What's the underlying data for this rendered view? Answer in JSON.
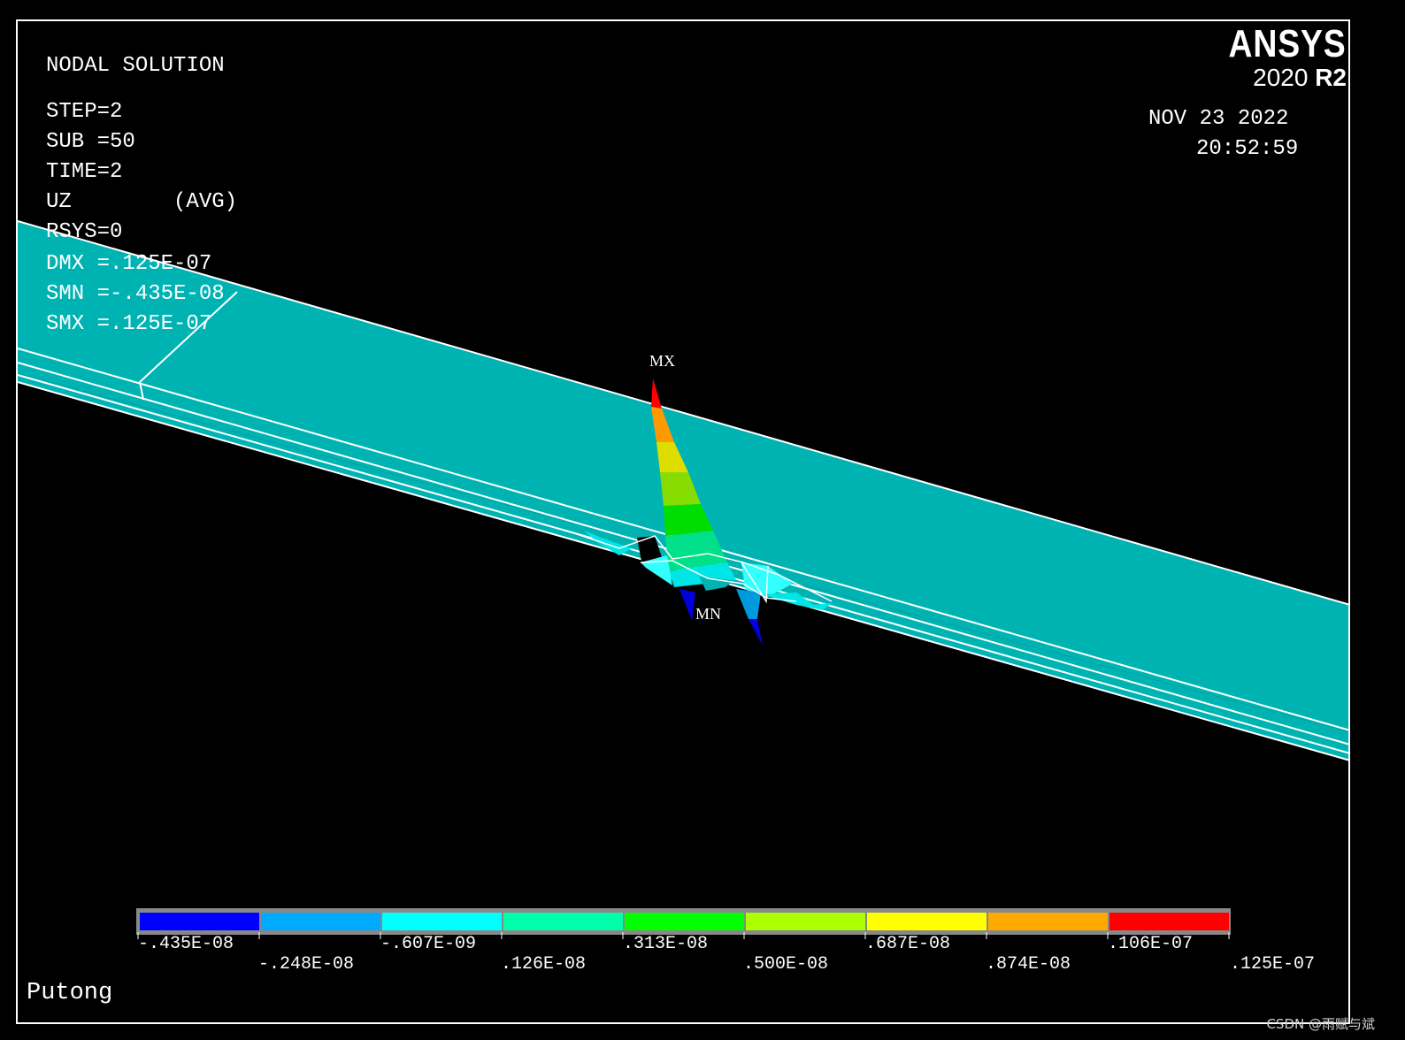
{
  "info": {
    "title": "NODAL SOLUTION",
    "step": "STEP=2",
    "sub": "SUB =50",
    "time": "TIME=2",
    "result": "UZ        (AVG)",
    "rsys": "RSYS=0",
    "dmx": "DMX =.125E-07",
    "smn": "SMN =-.435E-08",
    "smx": "SMX =.125E-07"
  },
  "brand": {
    "name": "ANSYS",
    "version_year": "2020",
    "version_release": "R2"
  },
  "datetime": {
    "date": "NOV 23 2022",
    "time": "20:52:59"
  },
  "markers": {
    "max": "MX",
    "min": "MN"
  },
  "legend": {
    "colors": [
      "#0000ff",
      "#00aaff",
      "#00ffff",
      "#00ffaa",
      "#00ff00",
      "#aaff00",
      "#ffff00",
      "#ffaa00",
      "#ff0000"
    ],
    "labels": [
      ".-435E-08",
      "-.248E-08",
      "-.607E-09",
      ".126E-08",
      ".313E-08",
      ".500E-08",
      ".687E-08",
      ".874E-08",
      ".106E-07",
      ".125E-07"
    ],
    "label_texts": [
      "-.435E-08",
      "-.248E-08",
      "-.607E-09",
      ".126E-08",
      ".313E-08",
      ".500E-08",
      ".687E-08",
      ".874E-08",
      ".106E-07",
      ".125E-07"
    ]
  },
  "title_bottom": "Putong",
  "watermark": "CSDN @雨赋与斌",
  "colors": {
    "background": "#000000",
    "plate": "#00b3b3",
    "edge": "#ffffff"
  }
}
